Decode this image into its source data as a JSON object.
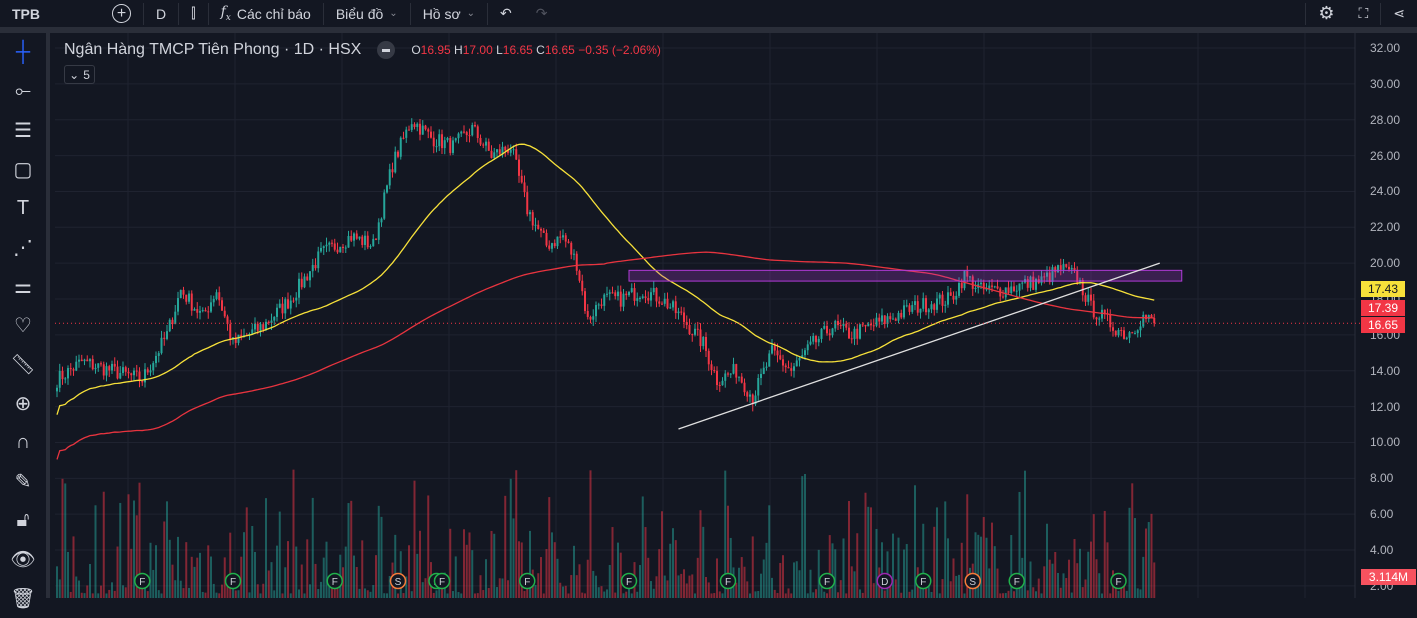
{
  "toolbar": {
    "symbol": "TPB",
    "interval": "D",
    "indicators": "Các chỉ báo",
    "chart": "Biểu đồ",
    "profile": "Hồ sơ"
  },
  "legend": {
    "title": "Ngân Hàng TMCP Tiên Phong · 1D · HSX",
    "o_label": "O",
    "o": "16.95",
    "h_label": "H",
    "h": "17.00",
    "l_label": "L",
    "l": "16.65",
    "c_label": "C",
    "c": "16.65",
    "change": "−0.35 (−2.06%)",
    "collapsed_count": "5"
  },
  "price_tags": {
    "ma_fast": "17.43",
    "ma_slow": "17.39",
    "last": "16.65",
    "volume": "3.114M"
  },
  "colors": {
    "up": "#26a69a",
    "down": "#f23645",
    "ma_fast": "#f7e13a",
    "ma_slow": "#e8343f",
    "box": "#b03ad8"
  },
  "chart_data": {
    "type": "candlestick",
    "symbol": "TPB",
    "ylim": [
      2,
      32
    ],
    "yticks": [
      "32.00",
      "30.00",
      "28.00",
      "26.00",
      "24.00",
      "22.00",
      "20.00",
      "18.00",
      "16.00",
      "14.00",
      "12.00",
      "10.00",
      "8.00",
      "6.00",
      "4.00",
      "2.00"
    ],
    "bars": 400,
    "close_path": [
      [
        0,
        13.5
      ],
      [
        9,
        14.5
      ],
      [
        20,
        14
      ],
      [
        31,
        13.5
      ],
      [
        40,
        16
      ],
      [
        45,
        18.5
      ],
      [
        53,
        17
      ],
      [
        58,
        18.5
      ],
      [
        64,
        15.5
      ],
      [
        75,
        16.5
      ],
      [
        85,
        18
      ],
      [
        96,
        20.5
      ],
      [
        107,
        21.5
      ],
      [
        115,
        21
      ],
      [
        122,
        25.5
      ],
      [
        129,
        28
      ],
      [
        136,
        27
      ],
      [
        144,
        26.5
      ],
      [
        151,
        27.5
      ],
      [
        158,
        26
      ],
      [
        165,
        26.5
      ],
      [
        171,
        23
      ],
      [
        178,
        21
      ],
      [
        184,
        21.5
      ],
      [
        189,
        20
      ],
      [
        193,
        16.8
      ],
      [
        198,
        18
      ],
      [
        205,
        18
      ],
      [
        213,
        18.5
      ],
      [
        220,
        18
      ],
      [
        227,
        17
      ],
      [
        235,
        15.5
      ],
      [
        240,
        13.5
      ],
      [
        247,
        14
      ],
      [
        253,
        12.5
      ],
      [
        260,
        15
      ],
      [
        267,
        14
      ],
      [
        275,
        15.5
      ],
      [
        282,
        16.5
      ],
      [
        289,
        16
      ],
      [
        296,
        16.5
      ],
      [
        304,
        17
      ],
      [
        311,
        17.5
      ],
      [
        318,
        17.8
      ],
      [
        325,
        18
      ],
      [
        330,
        19.3
      ],
      [
        336,
        18.5
      ],
      [
        344,
        18.5
      ],
      [
        351,
        18.8
      ],
      [
        358,
        19
      ],
      [
        365,
        19.7
      ],
      [
        371,
        19.2
      ],
      [
        376,
        17.5
      ],
      [
        384,
        16.5
      ],
      [
        389,
        16
      ],
      [
        395,
        17
      ],
      [
        399,
        16.65
      ]
    ],
    "volume_max_m": 9.3,
    "ma_fast_period": 50,
    "ma_slow_period": 200,
    "trendline": [
      [
        226,
        10.75
      ],
      [
        401,
        20.0
      ]
    ],
    "zone": {
      "from_bar": 208,
      "to_bar": 409,
      "top": 19.6,
      "bottom": 19.0
    },
    "events": [
      {
        "bar": 31,
        "t": "F"
      },
      {
        "bar": 64,
        "t": "F"
      },
      {
        "bar": 101,
        "t": "F"
      },
      {
        "bar": 124,
        "t": "S"
      },
      {
        "bar": 138,
        "t": "F"
      },
      {
        "bar": 140,
        "t": "F"
      },
      {
        "bar": 171,
        "t": "F"
      },
      {
        "bar": 208,
        "t": "F"
      },
      {
        "bar": 244,
        "t": "F"
      },
      {
        "bar": 280,
        "t": "F"
      },
      {
        "bar": 301,
        "t": "D"
      },
      {
        "bar": 315,
        "t": "F"
      },
      {
        "bar": 333,
        "t": "S"
      },
      {
        "bar": 349,
        "t": "F"
      },
      {
        "bar": 386,
        "t": "F"
      }
    ]
  }
}
